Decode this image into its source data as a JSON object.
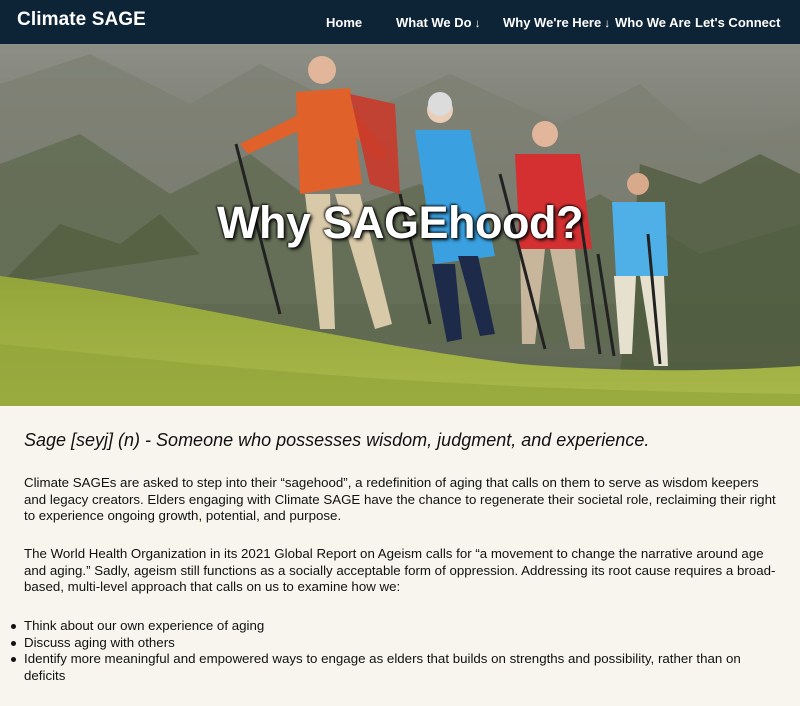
{
  "nav": {
    "brand": "Climate SAGE",
    "items": [
      {
        "label": "Home",
        "dropdown": false
      },
      {
        "label": "What We Do",
        "dropdown": true
      },
      {
        "label": "Why We're Here",
        "dropdown": true
      },
      {
        "label": "Who We Are",
        "dropdown": false
      },
      {
        "label": "Let's Connect",
        "dropdown": false
      }
    ],
    "arrow": "↓"
  },
  "hero": {
    "title": "Why SAGEhood?",
    "image_alt": "Four older adults hiking with trekking poles on a grassy alpine slope"
  },
  "content": {
    "definition": "Sage [seyj] (n) - Someone who possesses wisdom, judgment, and experience.",
    "paragraph1": "Climate SAGEs are asked to step into their “sagehood”, a redefinition of aging that calls on them to serve as wisdom keepers and legacy creators. Elders engaging with Climate SAGE have the chance to regenerate their societal role, reclaiming their right to experience ongoing growth, potential, and purpose.",
    "paragraph2": "The World Health Organization in its 2021 Global Report on Ageism calls for “a movement to change the narrative around age and aging.” Sadly, ageism still functions as a socially acceptable form of oppression. Addressing its root cause requires a broad-based, multi-level approach that calls on us to examine how we:",
    "list": [
      "Think about our own experience of aging",
      "Discuss aging with others",
      "Identify more meaningful and empowered ways to engage as elders that builds on strengths and possibility, rather than on deficits"
    ]
  },
  "colors": {
    "nav_bg": "#0d2336",
    "page_bg": "#f8f5ee",
    "text": "#111111"
  }
}
